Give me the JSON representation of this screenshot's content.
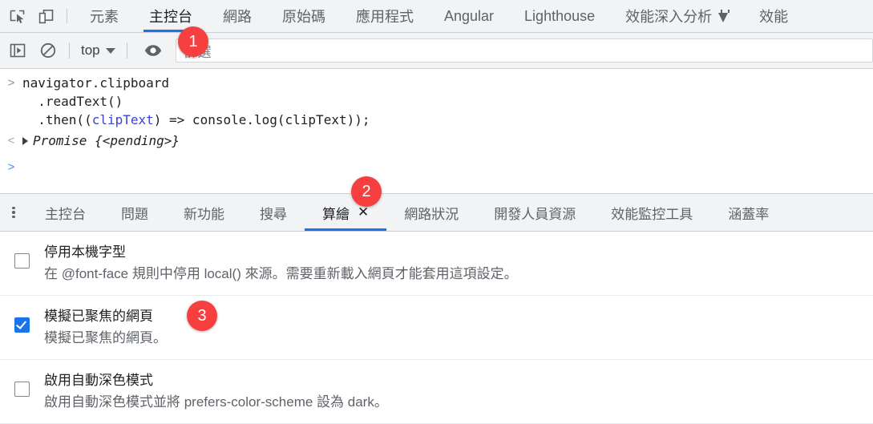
{
  "top_toolbar": {
    "inspect_icon": "inspect-element-icon",
    "device_icon": "device-toolbar-icon",
    "tabs": [
      {
        "label": "元素",
        "active": false
      },
      {
        "label": "主控台",
        "active": true
      },
      {
        "label": "網路",
        "active": false
      },
      {
        "label": "原始碼",
        "active": false
      },
      {
        "label": "應用程式",
        "active": false
      },
      {
        "label": "Angular",
        "active": false
      },
      {
        "label": "Lighthouse",
        "active": false
      },
      {
        "label": "效能深入分析",
        "active": false,
        "icon": "flask-icon"
      },
      {
        "label": "效能",
        "active": false
      }
    ]
  },
  "console_toolbar": {
    "sidebar_icon": "show-console-sidebar-icon",
    "clear_icon": "clear-console-icon",
    "context_value": "top",
    "eye_icon": "live-expression-eye-icon",
    "filter_placeholder": "篩選"
  },
  "console": {
    "prompt_glyph": ">",
    "return_glyph": "<",
    "command_lines": [
      "navigator.clipboard",
      "  .readText()",
      "  .then(("
    ],
    "command_line1": "navigator.clipboard",
    "command_line2": "  .readText()",
    "command_line3_pre": "  .then((",
    "command_line3_param": "clipText",
    "command_line3_post": ") => console.log(clipText));",
    "result": "Promise {<pending>}",
    "empty_prompt_glyph": ">"
  },
  "drawer": {
    "more_icon": "more-options-icon",
    "tabs": [
      {
        "label": "主控台",
        "active": false,
        "closable": false
      },
      {
        "label": "問題",
        "active": false,
        "closable": false
      },
      {
        "label": "新功能",
        "active": false,
        "closable": false
      },
      {
        "label": "搜尋",
        "active": false,
        "closable": false
      },
      {
        "label": "算繪",
        "active": true,
        "closable": true,
        "close_glyph": "✕"
      },
      {
        "label": "網路狀況",
        "active": false,
        "closable": false
      },
      {
        "label": "開發人員資源",
        "active": false,
        "closable": false
      },
      {
        "label": "效能監控工具",
        "active": false,
        "closable": false
      },
      {
        "label": "涵蓋率",
        "active": false,
        "closable": false
      }
    ]
  },
  "settings": [
    {
      "title": "停用本機字型",
      "desc": "在 @font-face 規則中停用 local() 來源。需要重新載入網頁才能套用這項設定。",
      "checked": false
    },
    {
      "title": "模擬已聚焦的網頁",
      "desc": "模擬已聚焦的網頁。",
      "checked": true
    },
    {
      "title": "啟用自動深色模式",
      "desc": "啟用自動深色模式並將 prefers-color-scheme 設為 dark。",
      "checked": false
    }
  ],
  "annotations": [
    {
      "id": "badge-1",
      "label": "1"
    },
    {
      "id": "badge-2",
      "label": "2"
    },
    {
      "id": "badge-3",
      "label": "3"
    }
  ],
  "colors": {
    "accent_blue": "#1a73e8",
    "badge_red": "#f73f3f",
    "toolbar_bg": "#f1f3f4",
    "text_primary": "#202124",
    "text_secondary": "#5f6368"
  }
}
